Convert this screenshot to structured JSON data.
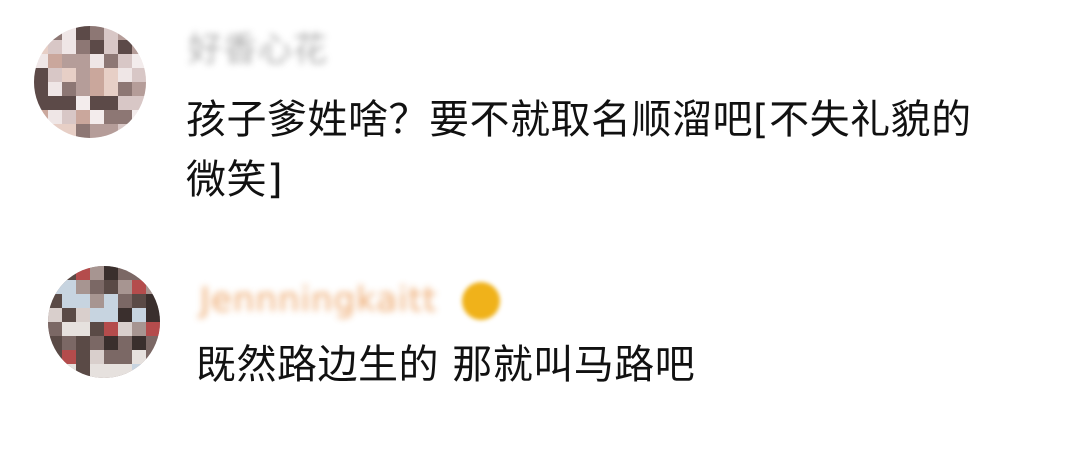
{
  "comments": [
    {
      "username": "好香心花",
      "username_color": "#9a9a9a",
      "text_line1": "孩子爹姓啥？要不就取名顺溜吧[不失礼貌的",
      "text_line2": "微笑]",
      "avatar_colors": [
        "#efe6e6",
        "#d8c7c6",
        "#b59d99",
        "#5c4a48",
        "#e7cfc6",
        "#caa79c",
        "#f3ecec",
        "#8d7774"
      ]
    },
    {
      "username": "Jennningkaitt",
      "username_color": "#e9934a",
      "badge_color": "#f0b21a",
      "text": "既然路边生的 那就叫马路吧",
      "avatar_colors": [
        "#5a4a46",
        "#a79591",
        "#d9cfcc",
        "#7b6865",
        "#c7d4e0",
        "#b44c4c",
        "#e6e1de",
        "#3a2f2d"
      ]
    }
  ]
}
